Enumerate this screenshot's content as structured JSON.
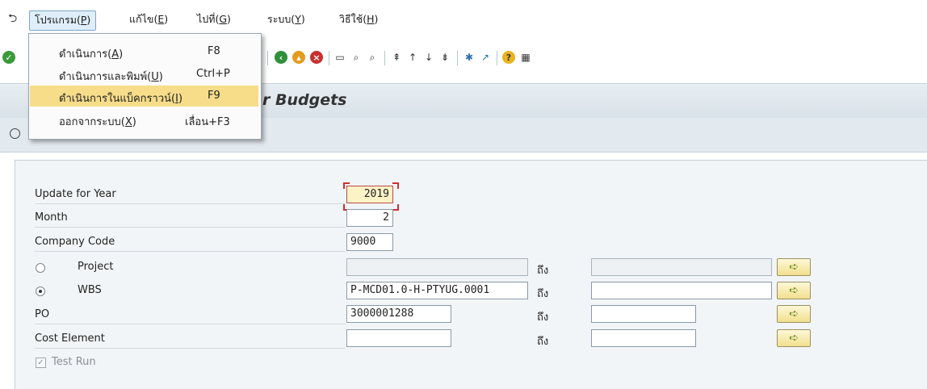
{
  "menubar": {
    "items": [
      {
        "text": "โปรแกรม(",
        "key": "P",
        "close": ")"
      },
      {
        "text": "แก้ไข(",
        "key": "E",
        "close": ")"
      },
      {
        "text": "ไปที่(",
        "key": "G",
        "close": ")"
      },
      {
        "text": "ระบบ(",
        "key": "Y",
        "close": ")"
      },
      {
        "text": "วิธีใช้(",
        "key": "H",
        "close": ")"
      }
    ]
  },
  "dropdown": {
    "items": [
      {
        "text": "ดำเนินการ(",
        "key": "A",
        "close": ")",
        "shortcut": "F8"
      },
      {
        "text": "ดำเนินการและพิมพ์(",
        "key": "U",
        "close": ")",
        "shortcut": "Ctrl+P"
      },
      {
        "text": "ดำเนินการในแบ็คกราวน์(",
        "key": "I",
        "close": ")",
        "shortcut": "F9"
      },
      {
        "text": "ออกจากระบบ(",
        "key": "X",
        "close": ")",
        "shortcut": "เลื่อน+F3"
      }
    ]
  },
  "title": "r Budgets",
  "form": {
    "update_year_label": "Update for Year",
    "update_year_value": "2019",
    "month_label": "Month",
    "month_value": "2",
    "company_code_label": "Company Code",
    "company_code_value": "9000",
    "project_label": "Project",
    "project_from": "",
    "project_to": "",
    "wbs_label": "WBS",
    "wbs_from": "P-MCD01.0-H-PTYUG.0001",
    "wbs_to": "",
    "po_label": "PO",
    "po_from": "3000001288",
    "po_to": "",
    "cost_element_label": "Cost Element",
    "cost_element_from": "",
    "cost_element_to": "",
    "to_label": "ถึง",
    "test_run_label": "Test Run"
  },
  "colors": {
    "highlight": "#f7dd8a",
    "titlebar": "#dde5ec",
    "focus_field": "#fbf3c6"
  }
}
